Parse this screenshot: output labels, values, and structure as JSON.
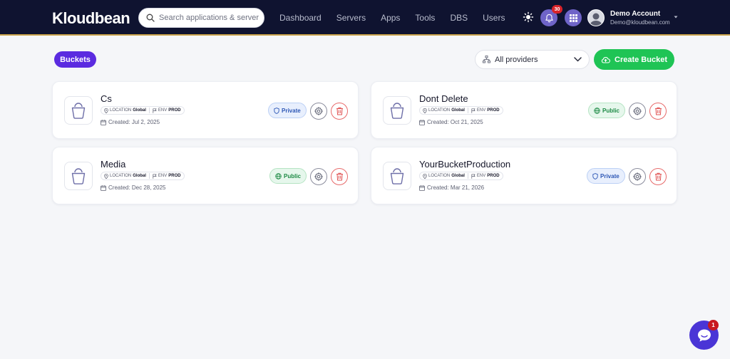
{
  "header": {
    "logo": "Kloudbean",
    "search_placeholder": "Search applications & servers...",
    "nav": [
      "Dashboard",
      "Servers",
      "Apps",
      "Tools",
      "DBS",
      "Users"
    ],
    "notification_count": "30",
    "account_name": "Demo Account",
    "account_email": "Demo@kloudbean.com"
  },
  "toolbar": {
    "buckets_label": "Buckets",
    "provider_select": "All providers",
    "create_label": "Create Bucket"
  },
  "labels": {
    "location": "LOCATION",
    "env": "ENV"
  },
  "buckets": [
    {
      "name": "Cs",
      "location": "Global",
      "env": "PROD",
      "created": "Created: Jul 2, 2025",
      "visibility": "Private"
    },
    {
      "name": "Dont Delete",
      "location": "Global",
      "env": "PROD",
      "created": "Created: Oct 21, 2025",
      "visibility": "Public"
    },
    {
      "name": "Media",
      "location": "Global",
      "env": "PROD",
      "created": "Created: Dec 28, 2025",
      "visibility": "Public"
    },
    {
      "name": "YourBucketProduction",
      "location": "Global",
      "env": "PROD",
      "created": "Created: Mar 21, 2026",
      "visibility": "Private"
    }
  ],
  "chat_badge": "1",
  "colors": {
    "header_bg": "#0f1330",
    "accent_purple": "#5b2be0",
    "create_green": "#1fc455",
    "private_blue": "#2d57b5",
    "public_green": "#1c8a44",
    "danger_red": "#e76a6a"
  },
  "icons": [
    "search-icon",
    "sun-icon",
    "bell-icon",
    "grid-icon",
    "user-icon",
    "chevron-down-icon",
    "network-icon",
    "cloud-upload-icon",
    "bucket-icon",
    "map-pin-icon",
    "flag-icon",
    "calendar-icon",
    "shield-icon",
    "globe-icon",
    "gear-icon",
    "trash-icon",
    "chat-icon"
  ]
}
